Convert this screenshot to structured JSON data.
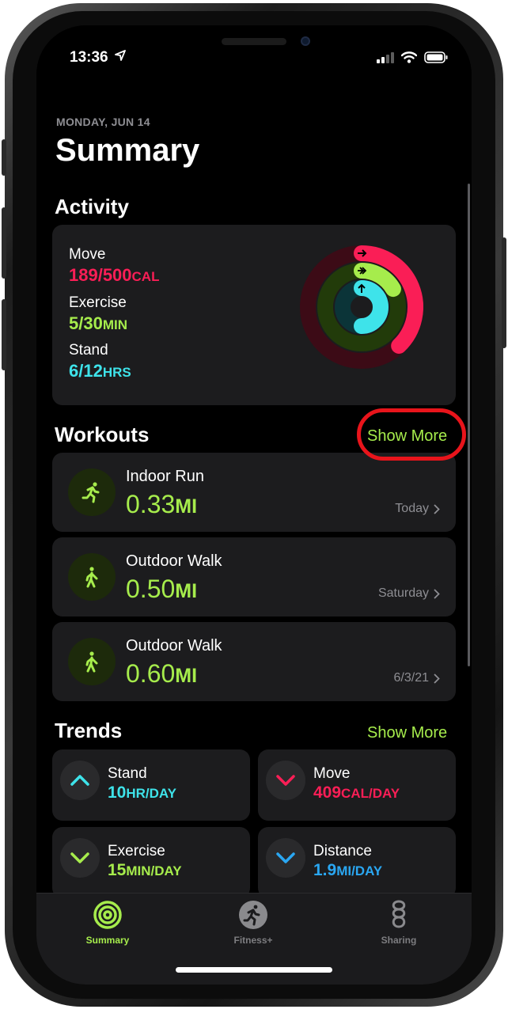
{
  "status_bar": {
    "time": "13:36"
  },
  "header": {
    "date": "MONDAY, JUN 14",
    "title": "Summary"
  },
  "activity": {
    "title": "Activity",
    "move": {
      "label": "Move",
      "value": "189/500",
      "unit": "CAL",
      "color": "#fa1e56",
      "progress": 0.378
    },
    "exercise": {
      "label": "Exercise",
      "value": "5/30",
      "unit": "MIN",
      "color": "#a6ec4c",
      "progress": 0.167
    },
    "stand": {
      "label": "Stand",
      "value": "6/12",
      "unit": "HRS",
      "color": "#3ee3ea",
      "progress": 0.5
    }
  },
  "workouts": {
    "title": "Workouts",
    "show_more": "Show More",
    "items": [
      {
        "name": "Indoor Run",
        "value": "0.33",
        "unit": "MI",
        "date": "Today",
        "icon": "running-figure-icon"
      },
      {
        "name": "Outdoor Walk",
        "value": "0.50",
        "unit": "MI",
        "date": "Saturday",
        "icon": "walking-figure-icon"
      },
      {
        "name": "Outdoor Walk",
        "value": "0.60",
        "unit": "MI",
        "date": "6/3/21",
        "icon": "walking-figure-icon"
      }
    ]
  },
  "trends": {
    "title": "Trends",
    "show_more": "Show More",
    "items": [
      {
        "name": "Stand",
        "value": "10",
        "unit": "HR/DAY",
        "direction": "up",
        "color": "#3ee3ea"
      },
      {
        "name": "Move",
        "value": "409",
        "unit": "CAL/DAY",
        "direction": "down",
        "color": "#fa1e56"
      },
      {
        "name": "Exercise",
        "value": "15",
        "unit": "MIN/DAY",
        "direction": "down",
        "color": "#a6ec4c"
      },
      {
        "name": "Distance",
        "value": "1.9",
        "unit": "MI/DAY",
        "direction": "down",
        "color": "#2aa7f2"
      }
    ]
  },
  "tab_bar": {
    "active_color": "#a6ec4c",
    "inactive_color": "#7d7d80",
    "tabs": [
      {
        "label": "Summary",
        "icon": "activity-rings-icon",
        "active": true
      },
      {
        "label": "Fitness+",
        "icon": "fitness-plus-runner-icon",
        "active": false
      },
      {
        "label": "Sharing",
        "icon": "sharing-icon",
        "active": false
      }
    ]
  },
  "annotation": {
    "color": "#e8141b"
  }
}
